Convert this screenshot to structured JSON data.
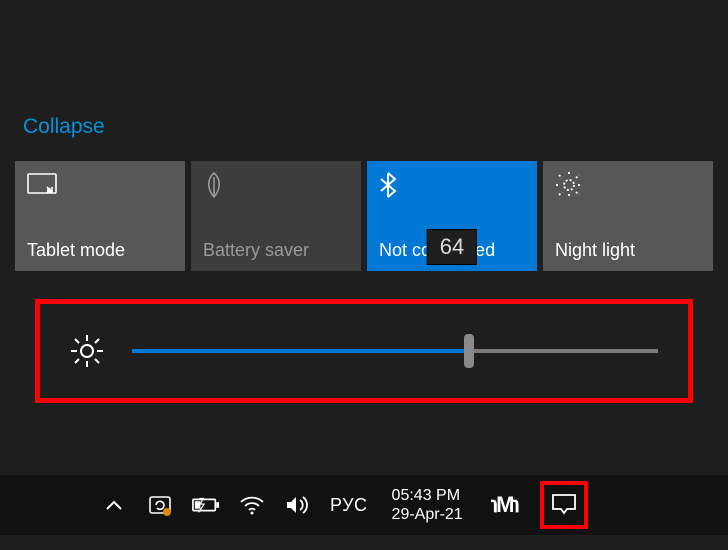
{
  "collapse_label": "Collapse",
  "tiles": [
    {
      "label": "Tablet mode",
      "icon": "tablet"
    },
    {
      "label": "Battery saver",
      "icon": "leaf"
    },
    {
      "label": "Not connected",
      "icon": "bluetooth"
    },
    {
      "label": "Night light",
      "icon": "nightlight"
    }
  ],
  "brightness": {
    "value": 64,
    "tooltip": "64"
  },
  "taskbar": {
    "language": "РУС",
    "time": "05:43 PM",
    "date": "29-Apr-21"
  },
  "colors": {
    "accent": "#0078d4",
    "highlight": "#ff0000"
  }
}
